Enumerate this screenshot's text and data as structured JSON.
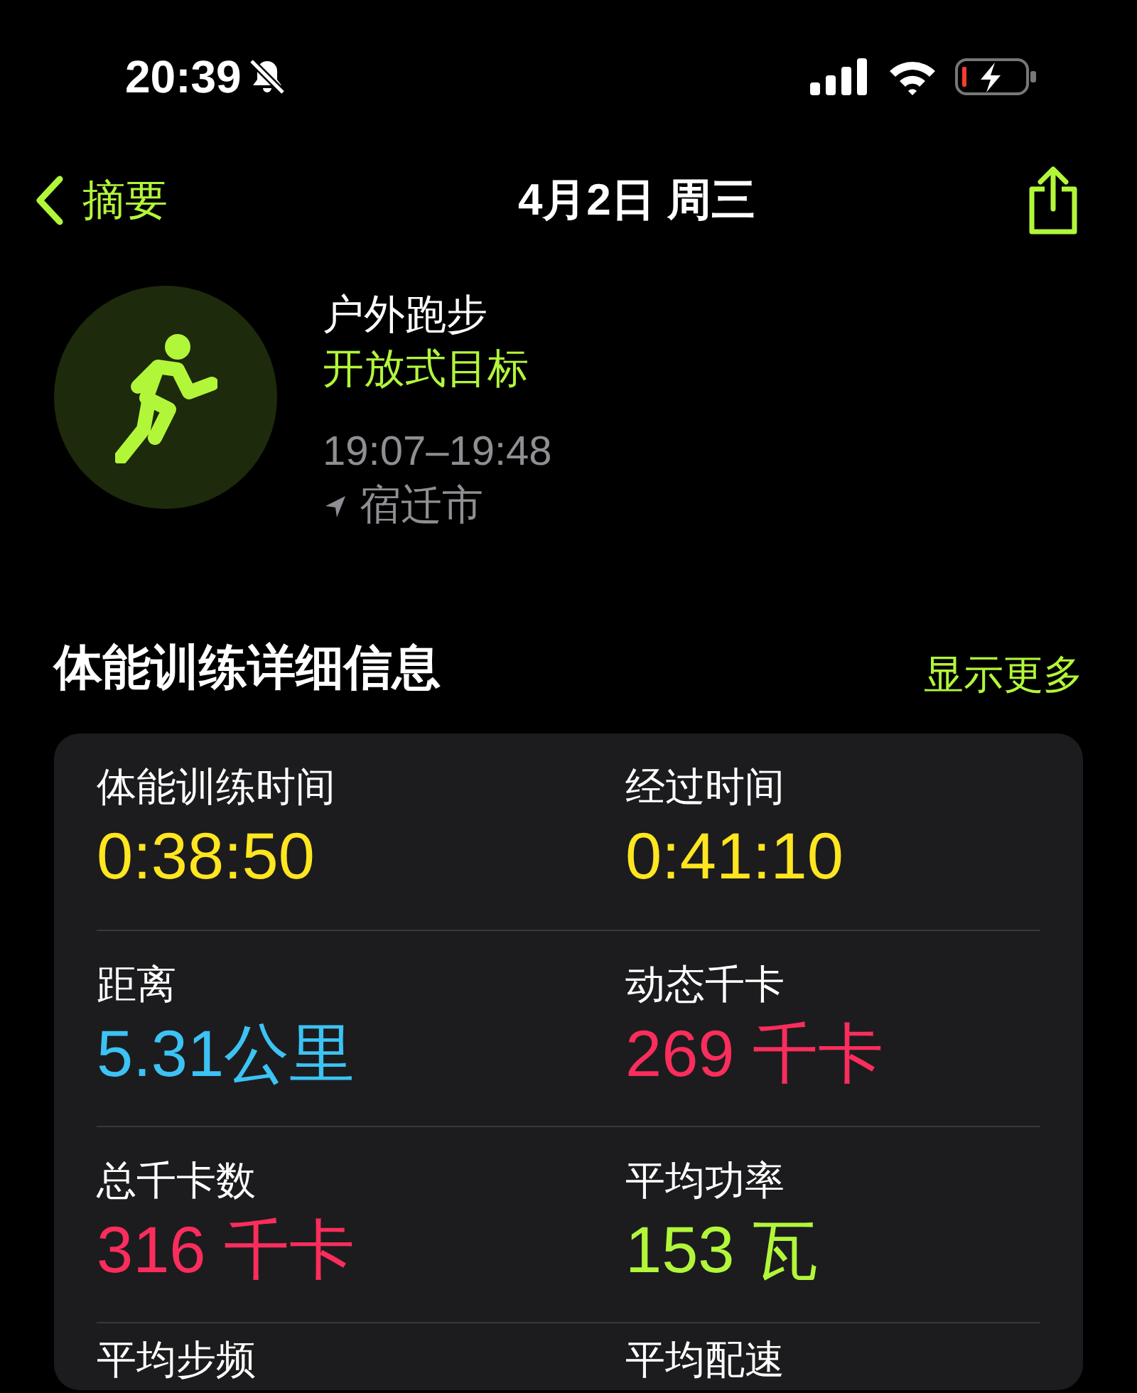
{
  "status_bar": {
    "time": "20:39",
    "silent": true
  },
  "nav": {
    "back_label": "摘要",
    "title": "4月2日 周三"
  },
  "workout": {
    "type": "户外跑步",
    "goal": "开放式目标",
    "time_range": "19:07–19:48",
    "location": "宿迁市"
  },
  "details": {
    "title": "体能训练详细信息",
    "action": "显示更多",
    "metrics": [
      {
        "label": "体能训练时间",
        "value": "0:38:50",
        "color": "#ffe620"
      },
      {
        "label": "经过时间",
        "value": "0:41:10",
        "color": "#ffe620"
      },
      {
        "label": "距离",
        "value": "5.31公里",
        "color": "#3cc3f4"
      },
      {
        "label": "动态千卡",
        "value": "269 千卡",
        "color": "#fa2d5c"
      },
      {
        "label": "总千卡数",
        "value": "316 千卡",
        "color": "#fa2d5c"
      },
      {
        "label": "平均功率",
        "value": "153 瓦",
        "color": "#b2f63a"
      },
      {
        "label": "平均步频"
      },
      {
        "label": "平均配速"
      }
    ]
  }
}
